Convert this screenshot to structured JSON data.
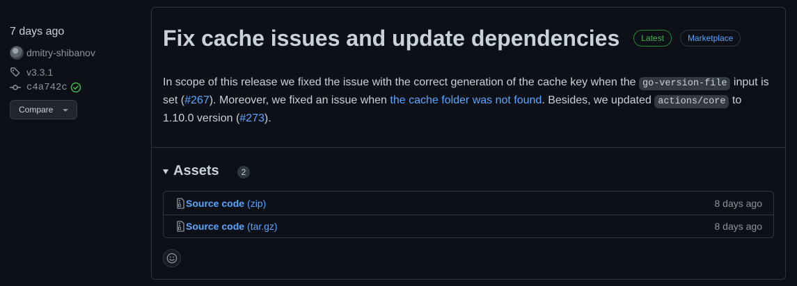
{
  "meta": {
    "date": "7 days ago",
    "author": "dmitry-shibanov",
    "tag": "v3.3.1",
    "commit": "c4a742c",
    "compare_label": "Compare"
  },
  "release": {
    "title": "Fix cache issues and update dependencies",
    "badge_latest": "Latest",
    "badge_marketplace": "Marketplace",
    "body": {
      "p1": "In scope of this release we fixed the issue with the correct generation of the cache key when the ",
      "code1": "go-version-file",
      "p2": " input is set (",
      "link1": "#267",
      "p3": "). Moreover, we fixed an issue when ",
      "link2": "the cache folder was not found",
      "p4": ". Besides, we updated ",
      "code2": "actions/core",
      "p5": " to 1.10.0 version (",
      "link3": "#273",
      "p6": ")."
    }
  },
  "assets": {
    "title": "Assets",
    "count": "2",
    "items": [
      {
        "name": "Source code",
        "ext": "(zip)",
        "date": "8 days ago"
      },
      {
        "name": "Source code",
        "ext": "(tar.gz)",
        "date": "8 days ago"
      }
    ]
  },
  "colors": {
    "background": "#0d1117",
    "border": "#30363d",
    "link": "#58a6ff",
    "latest_green": "#3fb950",
    "muted": "#8b949e"
  },
  "icons": [
    "tag-icon",
    "commit-icon",
    "verified-icon",
    "file-zip-icon",
    "smiley-icon",
    "triangle-down-icon"
  ]
}
